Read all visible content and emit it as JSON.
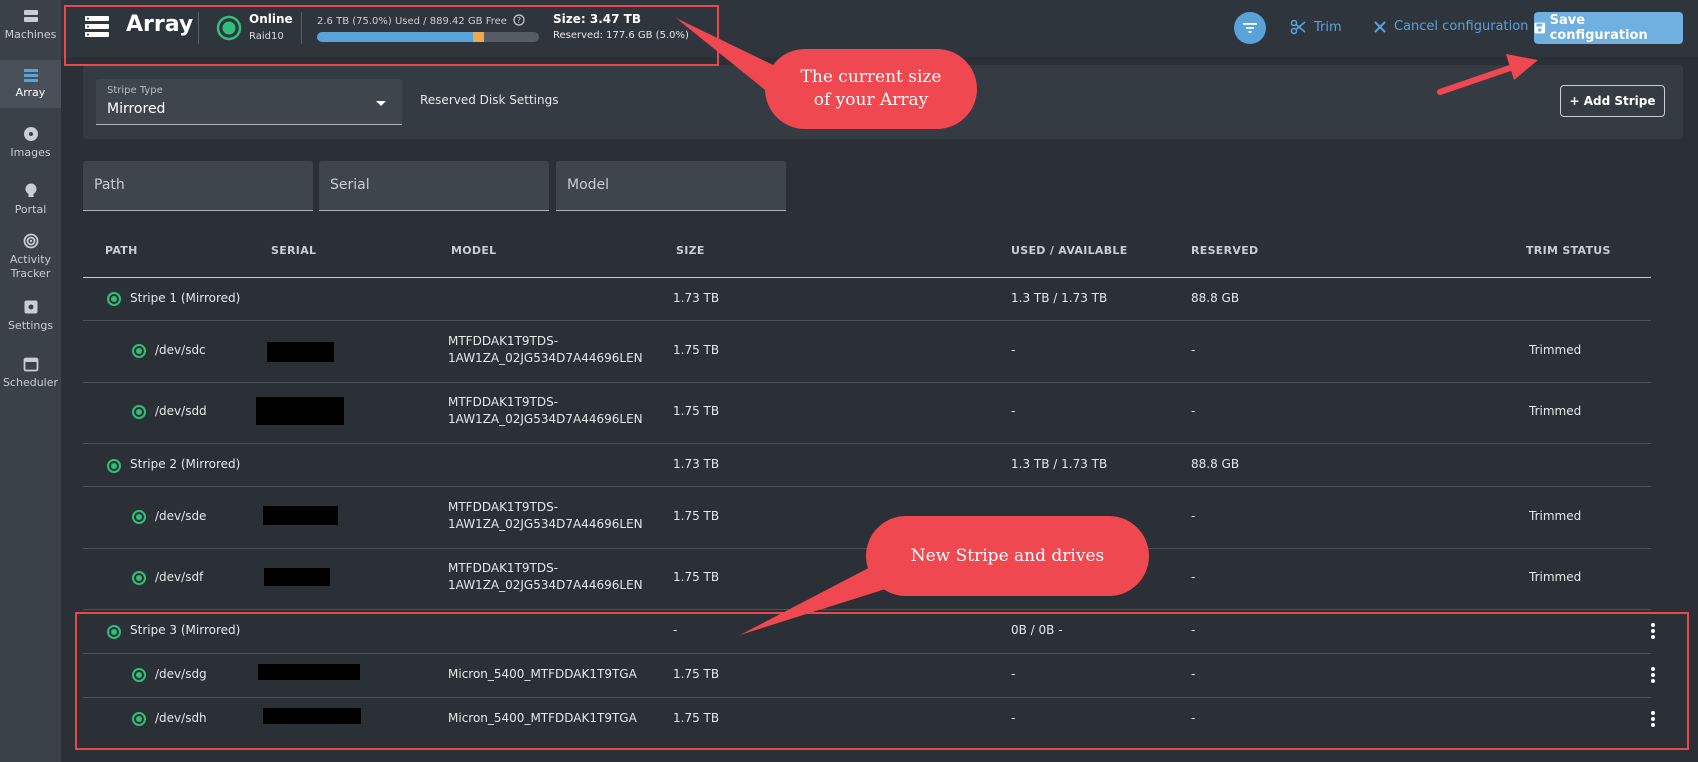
{
  "sidebar": {
    "items": [
      {
        "label": "Machines",
        "icon": "server-icon"
      },
      {
        "label": "Array",
        "icon": "array-icon",
        "active": true
      },
      {
        "label": "Images",
        "icon": "disc-icon"
      },
      {
        "label": "Portal",
        "icon": "bulb-icon"
      },
      {
        "label": "Activity Tracker",
        "icon": "activity-icon"
      },
      {
        "label": "Settings",
        "icon": "settings-icon"
      },
      {
        "label": "Scheduler",
        "icon": "calendar-icon"
      }
    ]
  },
  "header": {
    "title": "Array",
    "status": "Online",
    "raid": "Raid10",
    "usage_text": "2.6 TB (75.0%) Used / 889.42 GB Free",
    "usage_fraction": 0.75,
    "reserved_fraction": 0.05,
    "size_text": "Size: 3.47 TB",
    "reserved_text": "Reserved: 177.6 GB (5.0%)",
    "trim_label": "Trim",
    "cancel_label": "Cancel configuration",
    "save_label": "Save configuration"
  },
  "toolbar": {
    "stripe_type_label": "Stripe Type",
    "stripe_type_value": "Mirrored",
    "reserved_settings": "Reserved Disk Settings",
    "add_stripe": "+ Add Stripe"
  },
  "filters": {
    "path": "Path",
    "serial": "Serial",
    "model": "Model"
  },
  "table": {
    "columns": [
      "PATH",
      "SERIAL",
      "MODEL",
      "SIZE",
      "USED / AVAILABLE",
      "RESERVED",
      "TRIM STATUS"
    ],
    "rows": [
      {
        "path": "Stripe 1 (Mirrored)",
        "model": "",
        "size": "1.73 TB",
        "used": "1.3 TB / 1.73 TB",
        "reserved": "88.8 GB",
        "trim": ""
      },
      {
        "path": "/dev/sdc",
        "model": "MTFDDAK1T9TDS-\n1AW1ZA_02JG534D7A44696LEN",
        "size": "1.75 TB",
        "used": "-",
        "reserved": "-",
        "trim": "Trimmed"
      },
      {
        "path": "/dev/sdd",
        "model": "MTFDDAK1T9TDS-\n1AW1ZA_02JG534D7A44696LEN",
        "size": "1.75 TB",
        "used": "-",
        "reserved": "-",
        "trim": "Trimmed"
      },
      {
        "path": "Stripe 2 (Mirrored)",
        "model": "",
        "size": "1.73 TB",
        "used": "1.3 TB / 1.73 TB",
        "reserved": "88.8 GB",
        "trim": ""
      },
      {
        "path": "/dev/sde",
        "model": "MTFDDAK1T9TDS-\n1AW1ZA_02JG534D7A44696LEN",
        "size": "1.75 TB",
        "used": "",
        "reserved": "-",
        "trim": "Trimmed"
      },
      {
        "path": "/dev/sdf",
        "model": "MTFDDAK1T9TDS-\n1AW1ZA_02JG534D7A44696LEN",
        "size": "1.75 TB",
        "used": "",
        "reserved": "-",
        "trim": "Trimmed"
      },
      {
        "path": "Stripe 3 (Mirrored)",
        "model": "",
        "size": "-",
        "used": "0B / 0B -",
        "reserved": "-",
        "trim": ""
      },
      {
        "path": "/dev/sdg",
        "model": "Micron_5400_MTFDDAK1T9TGA",
        "size": "1.75 TB",
        "used": "-",
        "reserved": "-",
        "trim": ""
      },
      {
        "path": "/dev/sdh",
        "model": "Micron_5400_MTFDDAK1T9TGA",
        "size": "1.75 TB",
        "used": "-",
        "reserved": "-",
        "trim": ""
      }
    ]
  },
  "annotations": {
    "callout_size": "The current size\nof your Array",
    "callout_new": "New Stripe and drives",
    "accent_color": "#f04850"
  }
}
